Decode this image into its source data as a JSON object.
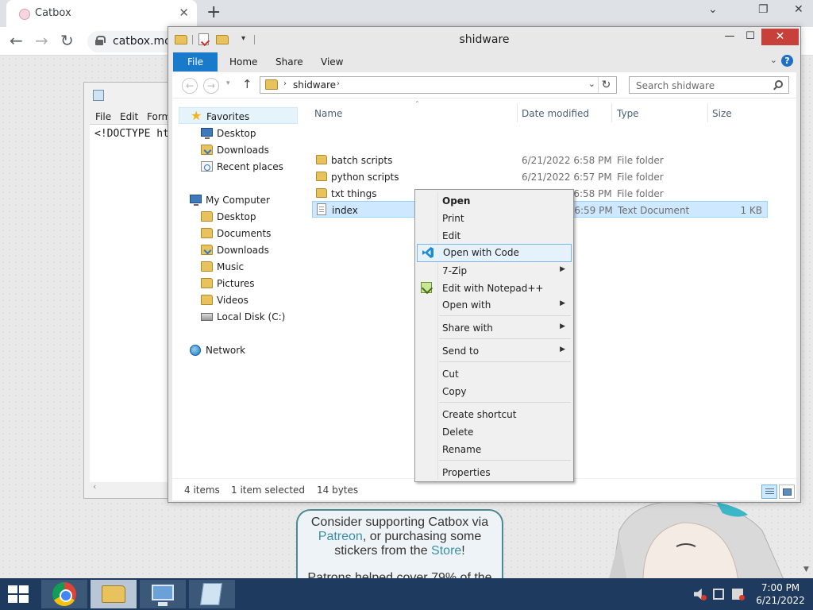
{
  "browser": {
    "tab_title": "Catbox",
    "tab_close": "✕",
    "new_tab": "+",
    "minimize": "⌄",
    "restore": "❐",
    "close": "✕",
    "back": "←",
    "forward": "→",
    "reload": "↻",
    "url": "catbox.moe"
  },
  "notepad": {
    "menu": [
      "File",
      "Edit",
      "Form"
    ],
    "content": "<!DOCTYPE ht",
    "scroll_left": "‹"
  },
  "catbox": {
    "support_line1": "Consider supporting Catbox via",
    "patreon": "Patreon",
    "support_line2": ", or purchasing some",
    "support_line3": "stickers from the ",
    "store": "Store",
    "support_line3_end": "!",
    "patrons_line": "Patrons helped cover 79% of the",
    "scroll_down": "▼"
  },
  "explorer": {
    "title": "shidware",
    "qat_arrow": "▾",
    "minimize": "—",
    "maximize": "☐",
    "close": "✕",
    "ribbon_tabs": {
      "file": "File",
      "home": "Home",
      "share": "Share",
      "view": "View"
    },
    "ribbon_expand": "⌄",
    "help": "?",
    "nav": {
      "back": "←",
      "forward": "→",
      "recent": "▾",
      "up": "↑"
    },
    "address": {
      "sep": "›",
      "crumb": "shidware",
      "dropdown": "⌄",
      "refresh": "↻"
    },
    "search_placeholder": "Search shidware",
    "nav_pane": {
      "favorites": "Favorites",
      "fav_items": [
        "Desktop",
        "Downloads",
        "Recent places"
      ],
      "computer": "My Computer",
      "computer_items": [
        "Desktop",
        "Documents",
        "Downloads",
        "Music",
        "Pictures",
        "Videos",
        "Local Disk (C:)"
      ],
      "network": "Network"
    },
    "columns": {
      "name": "Name",
      "date": "Date modified",
      "type": "Type",
      "size": "Size",
      "sort": "⌃"
    },
    "files": [
      {
        "name": "batch scripts",
        "date": "6/21/2022 6:58 PM",
        "type": "File folder",
        "size": ""
      },
      {
        "name": "python scripts",
        "date": "6/21/2022 6:57 PM",
        "type": "File folder",
        "size": ""
      },
      {
        "name": "txt things",
        "date": "6/21/2022 6:58 PM",
        "type": "File folder",
        "size": ""
      },
      {
        "name": "index",
        "date": "6/21/2022 6:59 PM",
        "type": "Text Document",
        "size": "1 KB"
      }
    ],
    "status": {
      "items": "4 items",
      "selected": "1 item selected",
      "bytes": "14 bytes"
    }
  },
  "context_menu": {
    "open": "Open",
    "print": "Print",
    "edit": "Edit",
    "open_with_code": "Open with Code",
    "seven_zip": "7-Zip",
    "edit_npp": "Edit with Notepad++",
    "open_with": "Open with",
    "share_with": "Share with",
    "send_to": "Send to",
    "cut": "Cut",
    "copy": "Copy",
    "create_shortcut": "Create shortcut",
    "delete": "Delete",
    "rename": "Rename",
    "properties": "Properties",
    "submenu_arrow": "▶"
  },
  "taskbar": {
    "time": "7:00 PM",
    "date": "6/21/2022"
  }
}
